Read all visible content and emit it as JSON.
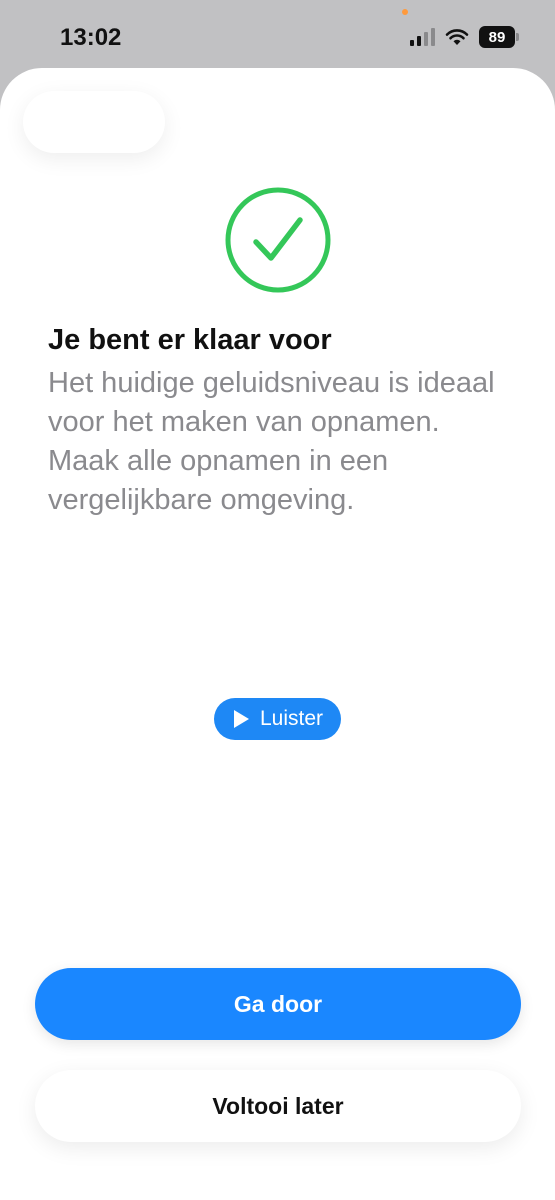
{
  "status_bar": {
    "time": "13:02",
    "battery_level": "89",
    "icons": [
      "cellular-signal-icon",
      "wifi-icon",
      "battery-icon"
    ]
  },
  "content": {
    "status_icon": "checkmark-circle-icon",
    "title": "Je bent er klaar voor",
    "description": "Het huidige geluidsniveau is ideaal voor het maken van opnamen. Maak alle opnamen in een vergelijkbare omgeving.",
    "listen_label": "Luister",
    "listen_icon": "play-icon"
  },
  "actions": {
    "primary_label": "Ga door",
    "secondary_label": "Voltooi later"
  },
  "colors": {
    "accent": "#1a87ff",
    "success": "#34c759",
    "secondary_text": "#8a8a8e"
  }
}
